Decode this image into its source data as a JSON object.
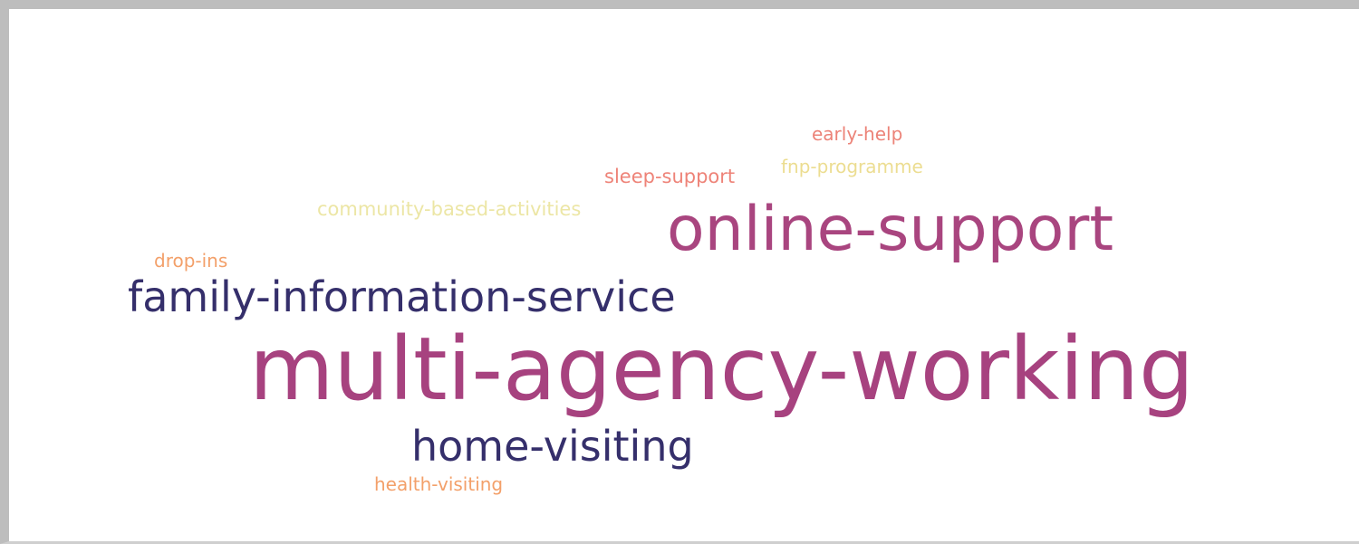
{
  "word_cloud": {
    "words": [
      {
        "id": "early-help",
        "text": "early-help",
        "color": "#ec8378"
      },
      {
        "id": "fnp-programme",
        "text": "fnp-programme",
        "color": "#ecdd91"
      },
      {
        "id": "sleep-support",
        "text": "sleep-support",
        "color": "#ee8378"
      },
      {
        "id": "community-based-activities",
        "text": "community-based-activities",
        "color": "#ece6a5"
      },
      {
        "id": "online-support",
        "text": "online-support",
        "color": "#a9457f"
      },
      {
        "id": "drop-ins",
        "text": "drop-ins",
        "color": "#f3a06a"
      },
      {
        "id": "family-information-service",
        "text": "family-information-service",
        "color": "#352f6b"
      },
      {
        "id": "multi-agency-working",
        "text": "multi-agency-working",
        "color": "#a7427f"
      },
      {
        "id": "home-visiting",
        "text": "home-visiting",
        "color": "#352f6b"
      },
      {
        "id": "health-visiting",
        "text": "health-visiting",
        "color": "#f3a06a"
      }
    ]
  }
}
